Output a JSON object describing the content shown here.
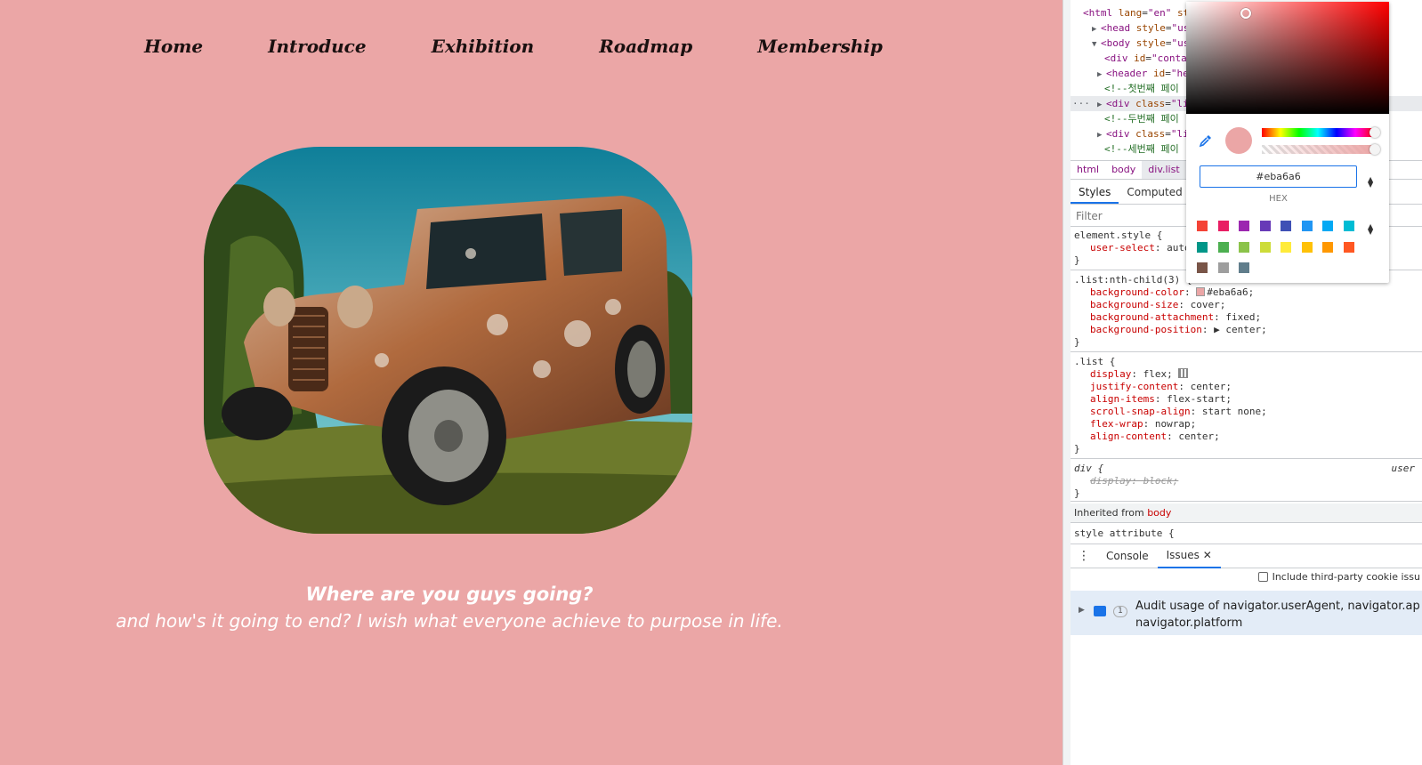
{
  "site": {
    "bg_color": "#eba6a6",
    "nav": [
      "Home",
      "Introduce",
      "Exhibition",
      "Roadmap",
      "Membership"
    ],
    "caption_title": "Where are you guys going?",
    "caption_sub": "and how's it going to end? I wish what everyone achieve to purpose in life."
  },
  "devtools": {
    "dom": [
      {
        "html": "<span class='tag'>&lt;html</span> <span class='attr'>lang</span>=<span class='tag'>\"en\"</span> <span class='attr'>st</span>"
      },
      {
        "html": "<span class='tri'>▶</span><span class='tag'>&lt;head</span> <span class='attr'>style</span>=<span class='tag'>\"use</span>"
      },
      {
        "html": "<span class='tri'>▼</span><span class='tag'>&lt;body</span> <span class='attr'>style</span>=<span class='tag'>\"use</span>"
      },
      {
        "html": "<span class='tag'>&lt;div</span> <span class='attr'>id</span>=<span class='tag'>\"conta</span>"
      },
      {
        "html": "<span class='tri'>▶</span><span class='tag'>&lt;header</span> <span class='attr'>id</span>=<span class='tag'>\"he</span>"
      },
      {
        "html": "<span class='comment'>&lt;!--첫번째 페이</span>"
      },
      {
        "html": "<span class='tri'>▶</span><span class='tag'>&lt;div</span> <span class='attr'>class</span>=<span class='tag'>\"li</span>"
      },
      {
        "html": "<span class='comment'>&lt;!--두번째 페이</span>"
      },
      {
        "html": "<span class='tri'>▶</span><span class='tag'>&lt;div</span> <span class='attr'>class</span>=<span class='tag'>\"li</span>"
      },
      {
        "html": "<span class='comment'>&lt;!--세번째 페이</span>"
      }
    ],
    "crumbs": [
      "html",
      "body",
      "div.list"
    ],
    "style_tabs": [
      "Styles",
      "Computed"
    ],
    "filter_placeholder": "Filter",
    "element_style_sel": "element.style {",
    "element_style_prop": "user-select",
    "element_style_val": "auto",
    "rule1_sel": ".list:nth-child(3) {",
    "rule1": [
      {
        "p": "background-color",
        "v": "#eba6a6;"
      },
      {
        "p": "background-size",
        "v": "cover;"
      },
      {
        "p": "background-attachment",
        "v": "fixed;"
      },
      {
        "p": "background-position",
        "v": "▶ center;"
      }
    ],
    "rule2_sel": ".list {",
    "rule2": [
      {
        "p": "display",
        "v": "flex;"
      },
      {
        "p": "justify-content",
        "v": "center;"
      },
      {
        "p": "align-items",
        "v": "flex-start;"
      },
      {
        "p": "scroll-snap-align",
        "v": "start none;"
      },
      {
        "p": "flex-wrap",
        "v": "nowrap;"
      },
      {
        "p": "align-content",
        "v": "center;"
      }
    ],
    "rule3_sel": "div {",
    "rule3_source": "user",
    "rule3_decl": "display: block;",
    "close_brace": "}",
    "inherited_label": "Inherited from",
    "inherited_from": "body",
    "style_attr": "style attribute {",
    "drawer_tabs": [
      "Console",
      "Issues"
    ],
    "third_party": "Include third-party cookie issu",
    "issue_line1": "Audit usage of navigator.userAgent, navigator.ap",
    "issue_line2": "navigator.platform",
    "issue_count": "1"
  },
  "picker": {
    "hex_value": "#eba6a6",
    "hex_label": "HEX",
    "current_color": "#eba6a6",
    "swatches": [
      "#f44336",
      "#e91e63",
      "#9c27b0",
      "#673ab7",
      "#3f51b5",
      "#2196f3",
      "#03a9f4",
      "#00bcd4",
      "#009688",
      "#4caf50",
      "#8bc34a",
      "#cddc39",
      "#ffeb3b",
      "#ffc107",
      "#ff9800",
      "#ff5722",
      "#795548",
      "#9e9e9e",
      "#607d8b"
    ]
  }
}
